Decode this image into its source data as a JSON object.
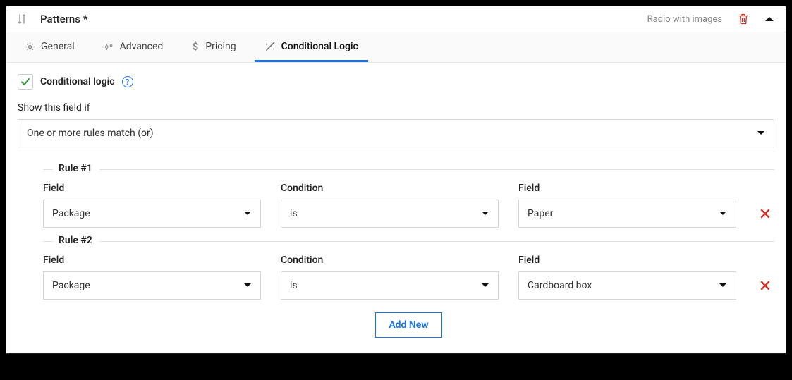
{
  "header": {
    "title": "Patterns *",
    "field_type": "Radio with images"
  },
  "tabs": [
    {
      "label": "General",
      "active": false
    },
    {
      "label": "Advanced",
      "active": false
    },
    {
      "label": "Pricing",
      "active": false
    },
    {
      "label": "Conditional Logic",
      "active": true
    }
  ],
  "enable": {
    "label": "Conditional logic",
    "checked": true,
    "help": "?"
  },
  "show_label": "Show this field if",
  "match_mode": "One or more rules match (or)",
  "column_labels": {
    "field": "Field",
    "condition": "Condition",
    "value": "Field"
  },
  "rules": [
    {
      "legend": "Rule #1",
      "field": "Package",
      "condition": "is",
      "value": "Paper"
    },
    {
      "legend": "Rule #2",
      "field": "Package",
      "condition": "is",
      "value": "Cardboard box"
    }
  ],
  "add_new_label": "Add New"
}
